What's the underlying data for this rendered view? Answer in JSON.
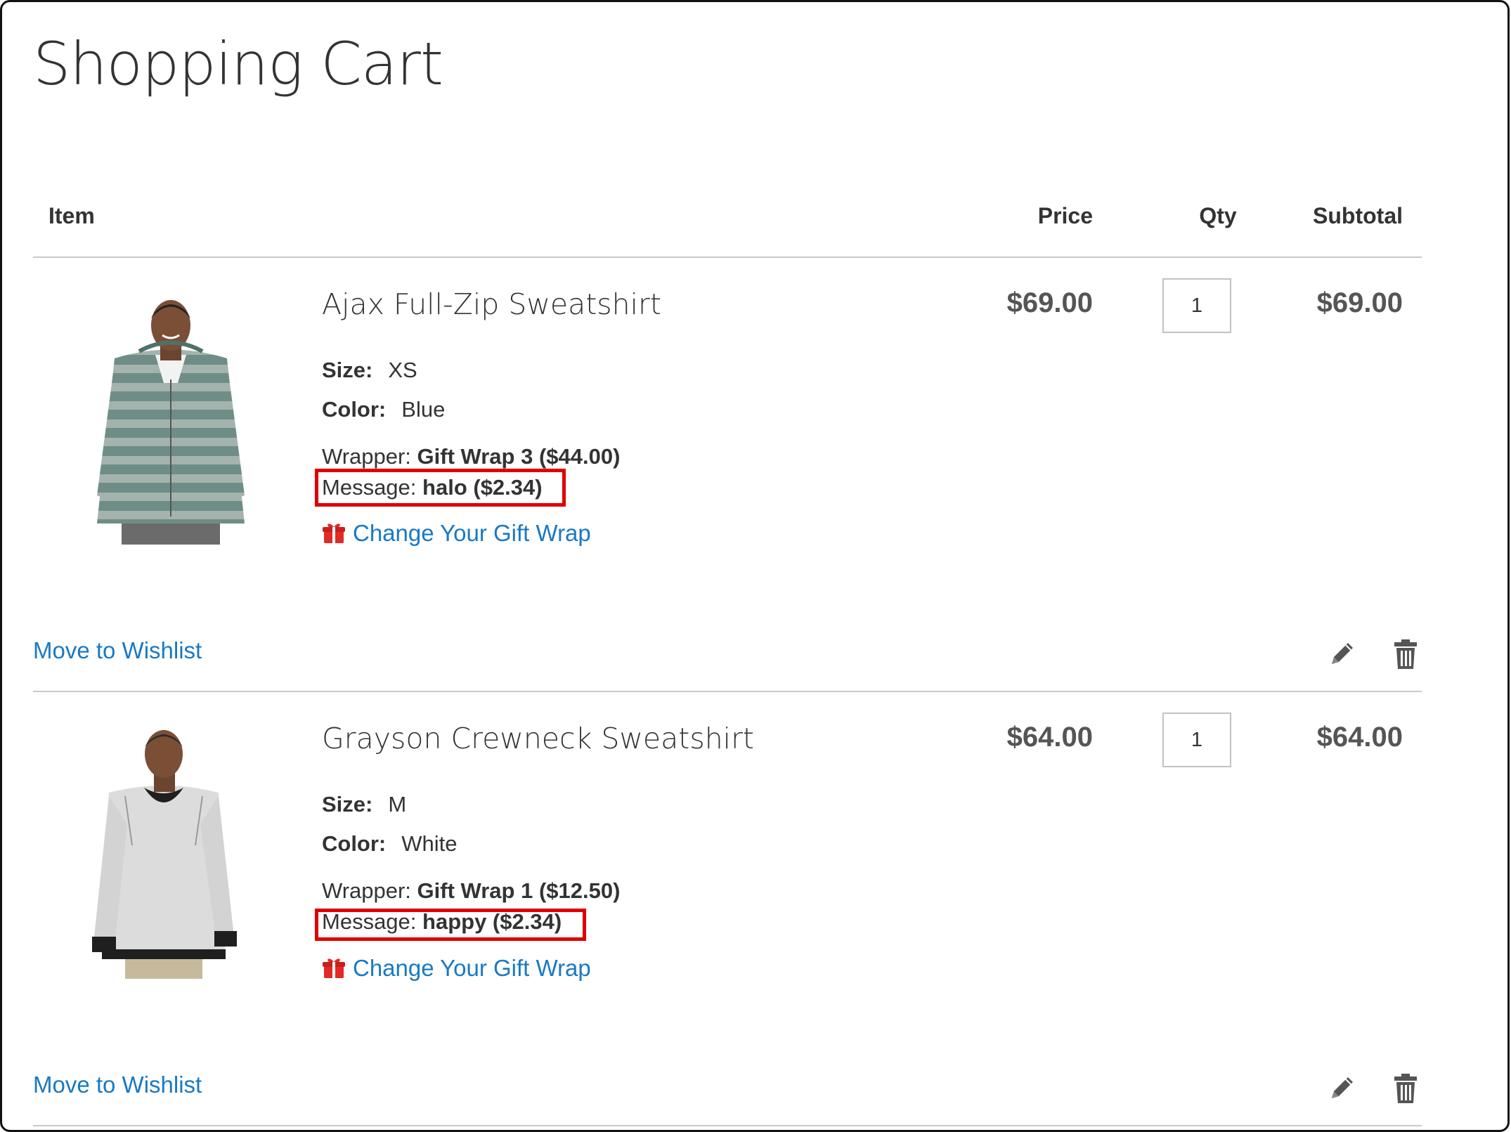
{
  "page": {
    "title": "Shopping Cart"
  },
  "table": {
    "headers": {
      "item": "Item",
      "price": "Price",
      "qty": "Qty",
      "subtotal": "Subtotal"
    }
  },
  "items": [
    {
      "name": "Ajax Full-Zip Sweatshirt",
      "size_label": "Size:",
      "size": "XS",
      "color_label": "Color:",
      "color": "Blue",
      "wrapper_label": "Wrapper:",
      "wrapper": "Gift Wrap 3 ($44.00)",
      "message_label": "Message:",
      "message": "halo ($2.34)",
      "gift_link": "Change Your Gift Wrap",
      "price": "$69.00",
      "qty": "1",
      "subtotal": "$69.00",
      "wishlist": "Move to Wishlist"
    },
    {
      "name": "Grayson Crewneck Sweatshirt",
      "size_label": "Size:",
      "size": "M",
      "color_label": "Color:",
      "color": "White",
      "wrapper_label": "Wrapper:",
      "wrapper": "Gift Wrap 1 ($12.50)",
      "message_label": "Message:",
      "message": "happy ($2.34)",
      "gift_link": "Change Your Gift Wrap",
      "price": "$64.00",
      "qty": "1",
      "subtotal": "$64.00",
      "wishlist": "Move to Wishlist"
    }
  ],
  "icons": {
    "gift": "gift-icon",
    "edit": "pencil-icon",
    "delete": "trash-icon"
  },
  "colors": {
    "link": "#1979c3",
    "highlight": "#e00000",
    "gift_icon": "#e02b27"
  }
}
